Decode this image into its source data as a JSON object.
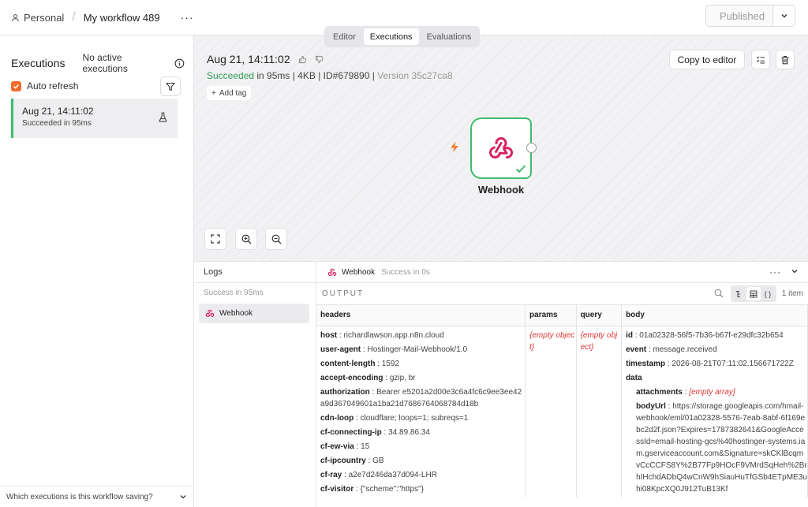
{
  "header": {
    "project": "Personal",
    "workflow_name": "My workflow 489",
    "publish_label": "Published"
  },
  "tabs": [
    "Editor",
    "Executions",
    "Evaluations"
  ],
  "sidebar": {
    "title": "Executions",
    "no_active": "No active executions",
    "auto_refresh": "Auto refresh",
    "execution": {
      "date": "Aug 21, 14:11:02",
      "status": "Succeeded in 95ms"
    },
    "bottom_question": "Which executions is this workflow saving?"
  },
  "run": {
    "date": "Aug 21, 14:11:02",
    "status_word": "Succeeded",
    "duration": " in 95ms | 4KB | ID#679890 | ",
    "version": "Version 35c27ca8",
    "add_tag": "Add tag",
    "copy_to_editor": "Copy to editor"
  },
  "node": {
    "label": "Webhook",
    "icon": "webhook-icon"
  },
  "logs": {
    "title": "Logs",
    "summary": "Success in 95ms",
    "node_label": "Webhook"
  },
  "output": {
    "node_name": "Webhook",
    "node_status": "Success in 0s",
    "label": "OUTPUT",
    "item_count": "1 item",
    "columns": [
      "headers",
      "params",
      "query",
      "body"
    ],
    "headers": [
      {
        "k": "host",
        "v": "richardlawson.app.n8n.cloud"
      },
      {
        "k": "user-agent",
        "v": "Hostinger-Mail-Webhook/1.0"
      },
      {
        "k": "content-length",
        "v": "1592"
      },
      {
        "k": "accept-encoding",
        "v": "gzip, br"
      },
      {
        "k": "authorization",
        "v": "Bearer e5201a2d00e3c6a4fc6c9ee3ee42a9d367049601a1ba21d7686764068784d18b"
      },
      {
        "k": "cdn-loop",
        "v": "cloudflare; loops=1; subreqs=1"
      },
      {
        "k": "cf-connecting-ip",
        "v": "34.89.86.34"
      },
      {
        "k": "cf-ew-via",
        "v": "15"
      },
      {
        "k": "cf-ipcountry",
        "v": "GB"
      },
      {
        "k": "cf-ray",
        "v": "a2e7d246da37d094-LHR"
      },
      {
        "k": "cf-visitor",
        "v": "{\"scheme\":\"https\"}"
      }
    ],
    "params_value": "{empty object}",
    "query_value": "{empty object}",
    "body": {
      "id": "01a02328-56f5-7b36-b67f-e29dfc32b654",
      "event": "message.received",
      "timestamp": "2026-08-21T07:11:02.156671722Z",
      "data_key": "data",
      "attachments": "[empty array]",
      "bodyUrl": "https://storage.googleapis.com/hmail-webhook/eml/01a02328-5576-7eab-8abf-6f169ebc2d2f.json?Expires=1787382641&GoogleAccessId=email-hosting-gcs%40hostinger-systems.iam.gserviceaccount.com&Signature=skCKlBcqmvCcCCFS8Y%2B77Fp9HOcF9VMrdSqHeh%2BrhIHchdADbQ4wCnW9hSiauHuTfGSb4ETpME3uhi08KpcXQ0J912TuB13Kf"
    }
  }
}
